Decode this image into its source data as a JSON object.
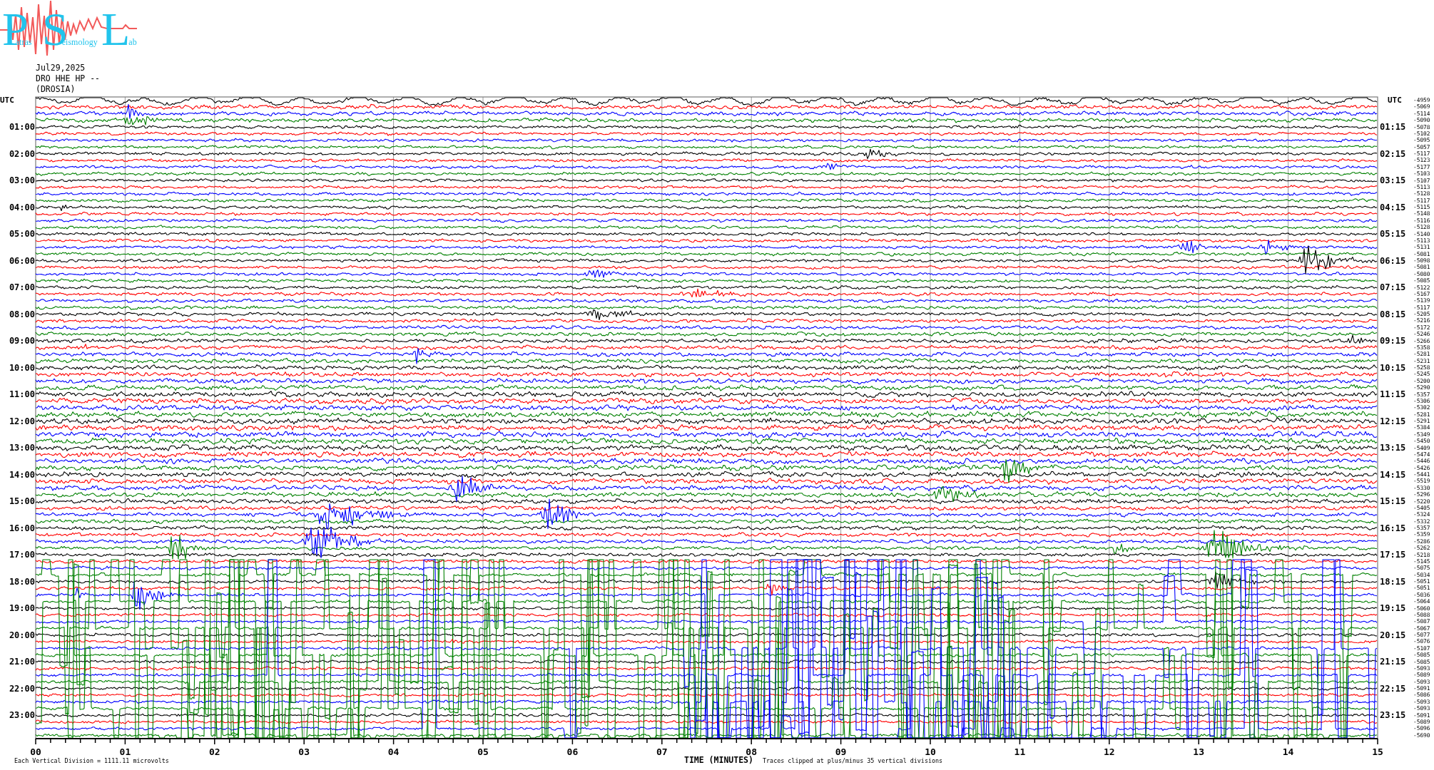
{
  "logo": {
    "words": [
      {
        "initial": "P",
        "rest": "atras"
      },
      {
        "initial": "S",
        "rest": "eismology"
      },
      {
        "initial": "L",
        "rest": "ab"
      }
    ]
  },
  "header": {
    "date": "Jul29,2025",
    "channel": "DRO HHE HP --",
    "station": "(DROSIA)"
  },
  "plot": {
    "left_title": "UTC",
    "right_title": "UTC",
    "left_labels": [
      "01:00",
      "02:00",
      "03:00",
      "04:00",
      "05:00",
      "06:00",
      "07:00",
      "08:00",
      "09:00",
      "10:00",
      "11:00",
      "12:00",
      "13:00",
      "14:00",
      "15:00",
      "16:00",
      "17:00",
      "18:00",
      "19:00",
      "20:00",
      "21:00",
      "22:00",
      "23:00"
    ],
    "right_labels": [
      "01:15",
      "02:15",
      "03:15",
      "04:15",
      "05:15",
      "06:15",
      "07:15",
      "08:15",
      "09:15",
      "10:15",
      "11:15",
      "12:15",
      "13:15",
      "14:15",
      "15:15",
      "16:15",
      "17:15",
      "18:15",
      "19:15",
      "20:15",
      "21:15",
      "22:15",
      "23:15"
    ],
    "traces": [
      {
        "color": "#000000",
        "value": "-4959"
      },
      {
        "color": "#ff0000",
        "value": "-5069"
      },
      {
        "color": "#0000ff",
        "value": "-5114"
      },
      {
        "color": "#008000",
        "value": "-5090"
      },
      {
        "color": "#000000",
        "value": "-5078"
      },
      {
        "color": "#ff0000",
        "value": "-5102"
      },
      {
        "color": "#0000ff",
        "value": "-5095"
      },
      {
        "color": "#008000",
        "value": "-5057"
      },
      {
        "color": "#000000",
        "value": "-5117"
      },
      {
        "color": "#ff0000",
        "value": "-5123"
      },
      {
        "color": "#0000ff",
        "value": "-5177"
      },
      {
        "color": "#008000",
        "value": "-5103"
      },
      {
        "color": "#000000",
        "value": "-5107"
      },
      {
        "color": "#ff0000",
        "value": "-5113"
      },
      {
        "color": "#0000ff",
        "value": "-5128"
      },
      {
        "color": "#008000",
        "value": "-5117"
      },
      {
        "color": "#000000",
        "value": "-5115"
      },
      {
        "color": "#ff0000",
        "value": "-5148"
      },
      {
        "color": "#0000ff",
        "value": "-5116"
      },
      {
        "color": "#008000",
        "value": "-5128"
      },
      {
        "color": "#000000",
        "value": "-5140"
      },
      {
        "color": "#ff0000",
        "value": "-5113"
      },
      {
        "color": "#0000ff",
        "value": "-5131"
      },
      {
        "color": "#008000",
        "value": "-5081"
      },
      {
        "color": "#000000",
        "value": "-5098"
      },
      {
        "color": "#ff0000",
        "value": "-5081"
      },
      {
        "color": "#0000ff",
        "value": "-5080"
      },
      {
        "color": "#008000",
        "value": "-5085"
      },
      {
        "color": "#000000",
        "value": "-5122"
      },
      {
        "color": "#ff0000",
        "value": "-5167"
      },
      {
        "color": "#0000ff",
        "value": "-5139"
      },
      {
        "color": "#008000",
        "value": "-5117"
      },
      {
        "color": "#000000",
        "value": "-5205"
      },
      {
        "color": "#ff0000",
        "value": "-5216"
      },
      {
        "color": "#0000ff",
        "value": "-5172"
      },
      {
        "color": "#008000",
        "value": "-5246"
      },
      {
        "color": "#000000",
        "value": "-5266"
      },
      {
        "color": "#ff0000",
        "value": "-5358"
      },
      {
        "color": "#0000ff",
        "value": "-5281"
      },
      {
        "color": "#008000",
        "value": "-5231"
      },
      {
        "color": "#000000",
        "value": "-5258"
      },
      {
        "color": "#ff0000",
        "value": "-5245"
      },
      {
        "color": "#0000ff",
        "value": "-5200"
      },
      {
        "color": "#008000",
        "value": "-5290"
      },
      {
        "color": "#000000",
        "value": "-5357"
      },
      {
        "color": "#ff0000",
        "value": "-5306"
      },
      {
        "color": "#0000ff",
        "value": "-5302"
      },
      {
        "color": "#008000",
        "value": "-5281"
      },
      {
        "color": "#000000",
        "value": "-5291"
      },
      {
        "color": "#ff0000",
        "value": "-5384"
      },
      {
        "color": "#0000ff",
        "value": "-5349"
      },
      {
        "color": "#008000",
        "value": "-5450"
      },
      {
        "color": "#000000",
        "value": "-5409"
      },
      {
        "color": "#ff0000",
        "value": "-5474"
      },
      {
        "color": "#0000ff",
        "value": "-5446"
      },
      {
        "color": "#008000",
        "value": "-5426"
      },
      {
        "color": "#000000",
        "value": "-5441"
      },
      {
        "color": "#ff0000",
        "value": "-5519"
      },
      {
        "color": "#0000ff",
        "value": "-5330"
      },
      {
        "color": "#008000",
        "value": "-5296"
      },
      {
        "color": "#000000",
        "value": "-5220"
      },
      {
        "color": "#ff0000",
        "value": "-5405"
      },
      {
        "color": "#0000ff",
        "value": "-5324"
      },
      {
        "color": "#008000",
        "value": "-5332"
      },
      {
        "color": "#000000",
        "value": "-5357"
      },
      {
        "color": "#ff0000",
        "value": "-5359"
      },
      {
        "color": "#0000ff",
        "value": "-5286"
      },
      {
        "color": "#008000",
        "value": "-5262"
      },
      {
        "color": "#000000",
        "value": "-5218"
      },
      {
        "color": "#ff0000",
        "value": "-5145"
      },
      {
        "color": "#0000ff",
        "value": "-5075"
      },
      {
        "color": "#008000",
        "value": "-5034"
      },
      {
        "color": "#000000",
        "value": "-5051"
      },
      {
        "color": "#ff0000",
        "value": "-5051"
      },
      {
        "color": "#0000ff",
        "value": "-5036"
      },
      {
        "color": "#008000",
        "value": "-5064"
      },
      {
        "color": "#000000",
        "value": "-5060"
      },
      {
        "color": "#ff0000",
        "value": "-5088"
      },
      {
        "color": "#0000ff",
        "value": "-5087"
      },
      {
        "color": "#008000",
        "value": "-5067"
      },
      {
        "color": "#000000",
        "value": "-5077"
      },
      {
        "color": "#ff0000",
        "value": "-5076"
      },
      {
        "color": "#0000ff",
        "value": "-5107"
      },
      {
        "color": "#008000",
        "value": "-5085"
      },
      {
        "color": "#000000",
        "value": "-5085"
      },
      {
        "color": "#ff0000",
        "value": "-5093"
      },
      {
        "color": "#0000ff",
        "value": "-5089"
      },
      {
        "color": "#008000",
        "value": "-5093"
      },
      {
        "color": "#000000",
        "value": "-5091"
      },
      {
        "color": "#ff0000",
        "value": "-5086"
      },
      {
        "color": "#0000ff",
        "value": "-5093"
      },
      {
        "color": "#008000",
        "value": "-5093"
      },
      {
        "color": "#000000",
        "value": "-5091"
      },
      {
        "color": "#ff0000",
        "value": "-5089"
      },
      {
        "color": "#0000ff",
        "value": "-5096"
      },
      {
        "color": "#008000",
        "value": "-5690"
      }
    ],
    "x_ticks": [
      "00",
      "01",
      "02",
      "03",
      "04",
      "05",
      "06",
      "07",
      "08",
      "09",
      "10",
      "11",
      "12",
      "13",
      "14",
      "15"
    ],
    "xlabel": "TIME (MINUTES)",
    "clip_note": "Traces clipped at plus/minus 35 vertical divisions",
    "scale_note": "Each Vertical Division = 1111.11 microvolts"
  }
}
